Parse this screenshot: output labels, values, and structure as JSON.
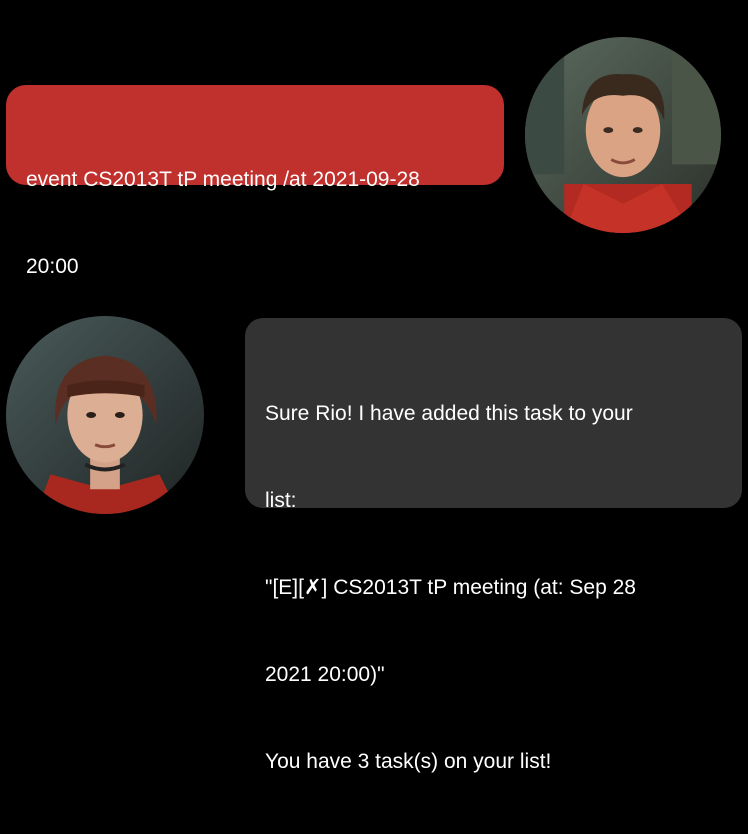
{
  "conversation": {
    "user_message": {
      "lines": [
        "event CS2013T tP meeting /at 2021-09-28",
        "20:00"
      ],
      "bubble_color": "#c0302c"
    },
    "bot_message": {
      "lines": [
        "Sure Rio! I have added this task to your",
        "list:",
        "\"[E][✗] CS2013T tP meeting (at: Sep 28",
        "2021 20:00)\"",
        "You have 3 task(s) on your list!"
      ],
      "bubble_color": "#333333"
    }
  },
  "avatars": {
    "user": "user-avatar-photo",
    "bot": "bot-avatar-photo"
  },
  "background_color": "#000000"
}
